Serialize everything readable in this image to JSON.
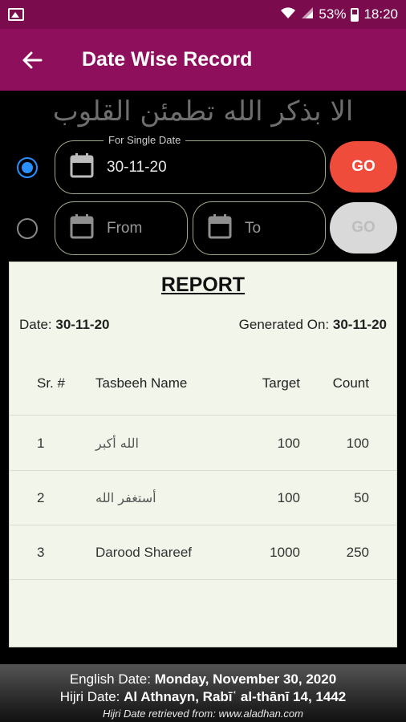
{
  "status_bar": {
    "battery": "53%",
    "time": "18:20"
  },
  "app_bar": {
    "title": "Date Wise Record",
    "back_icon": "arrow-back-icon"
  },
  "header": {
    "calligraphy": "الا بذكر الله تطمئن القلوب"
  },
  "single_date": {
    "label": "For Single Date",
    "value": "30-11-20",
    "selected": true,
    "go_label": "GO"
  },
  "range": {
    "from_placeholder": "From",
    "to_placeholder": "To",
    "selected": false,
    "go_label": "GO"
  },
  "report": {
    "title": "REPORT",
    "date_label": "Date:",
    "date_value": "30-11-20",
    "generated_label": "Generated On:",
    "generated_value": "30-11-20",
    "columns": [
      "Sr. #",
      "Tasbeeh Name",
      "Target",
      "Count"
    ],
    "rows": [
      {
        "sr": "1",
        "name": "الله أكبر",
        "target": "100",
        "count": "100"
      },
      {
        "sr": "2",
        "name": "أستغفر الله",
        "target": "100",
        "count": "50"
      },
      {
        "sr": "3",
        "name": "Darood Shareef",
        "target": "1000",
        "count": "250"
      }
    ]
  },
  "footer": {
    "english_label": "English Date:",
    "english_value": "Monday, November 30, 2020",
    "hijri_label": "Hijri Date:",
    "hijri_value": "Al Athnayn, Rabīʿ al-thānī 14, 1442",
    "source": "Hijri Date retrieved from: www.aladhan.com"
  },
  "colors": {
    "status_bar": "#7a0c4e",
    "app_bar": "#8e0f5c",
    "go_active": "#ef4c3c",
    "radio_active": "#2a90ff"
  }
}
